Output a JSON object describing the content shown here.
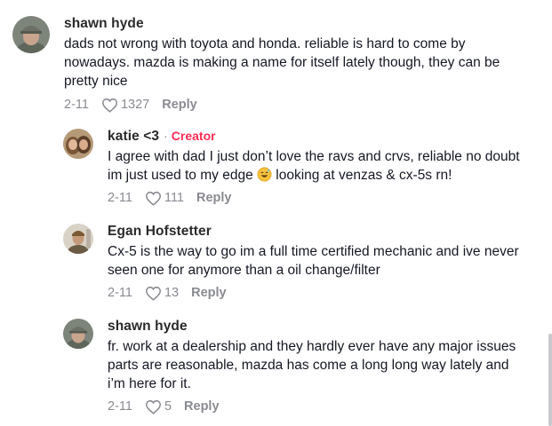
{
  "comments": [
    {
      "author": "shawn hyde",
      "text": "dads not wrong with toyota and honda. reliable is hard to come by nowadays. mazda is making a name for itself lately though, they can be pretty nice",
      "date": "2-11",
      "likes": "1327",
      "reply_label": "Reply"
    },
    {
      "author": "katie <3",
      "separator": "·",
      "badge": "Creator",
      "text_before_emoji": "I agree with dad I just don’t love the ravs and crvs, reliable no doubt im just used to my edge ",
      "emoji": "sweat-smile-emoji",
      "text_after_emoji": " looking at venzas & cx-5s rn!",
      "date": "2-11",
      "likes": "111",
      "reply_label": "Reply"
    },
    {
      "author": "Egan Hofstetter",
      "text": "Cx-5 is the way to go im a full time certified mechanic and ive never seen one for anymore than a oil change/filter",
      "date": "2-11",
      "likes": "13",
      "reply_label": "Reply"
    },
    {
      "author": "shawn hyde",
      "text": "fr. work at a dealership and they hardly ever have any major issues parts are reasonable, mazda has come a long long way lately and i’m here for it.",
      "date": "2-11",
      "likes": "5",
      "reply_label": "Reply"
    }
  ],
  "colors": {
    "creator_badge": "#fe2c55",
    "muted": "#8a8b91",
    "text": "#161823"
  }
}
